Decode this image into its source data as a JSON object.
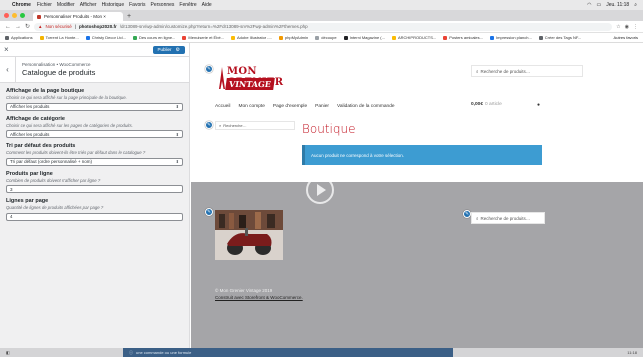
{
  "menubar": {
    "app": "Chrome",
    "items": [
      "Fichier",
      "Modifier",
      "Afficher",
      "Historique",
      "Favoris",
      "Personnes",
      "Fenêtre",
      "Aide"
    ],
    "clock": "Jeu. 11:18"
  },
  "tab": {
    "title": "Personnaliser Produits - Mon ×"
  },
  "address": {
    "warning": "Non sécurisé",
    "host": "photoshop2020.fr",
    "path": "/dr13089-srv/wp-admin/customize.php?return=%2Fdr13089-srv%2Fwp-admin%2Fthemes.php"
  },
  "bookmarks": [
    {
      "label": "Applications",
      "color": "#5f6368"
    },
    {
      "label": "Torrent La Honte...",
      "color": "#f4b400"
    },
    {
      "label": "Christy Decor Ltd...",
      "color": "#1a73e8"
    },
    {
      "label": "Des cours en ligne...",
      "color": "#34a853"
    },
    {
      "label": "Menuiserie et Ébé...",
      "color": "#ea4335"
    },
    {
      "label": "Adobe Illustrator -...",
      "color": "#fbbc05"
    },
    {
      "label": "phpMyAdmin",
      "color": "#f29900"
    },
    {
      "label": "découpe",
      "color": "#9aa0a6"
    },
    {
      "label": "Interni Magazine (...",
      "color": "#202124"
    },
    {
      "label": "ARCHIPRODUCTS...",
      "color": "#fbbc05"
    },
    {
      "label": "Posters amicales...",
      "color": "#ea4335"
    },
    {
      "label": "Impression planch...",
      "color": "#1a73e8"
    },
    {
      "label": "Créer des Tags NF...",
      "color": "#5f6368"
    }
  ],
  "bookmarks_other": "Autres favoris",
  "sidebar": {
    "publish_label": "Publier",
    "crumb": "Personnalisation • WooCommerce",
    "title": "Catalogue de produits",
    "controls": [
      {
        "label": "Affichage de la page boutique",
        "desc": "Choisir ce qui sera affiché sur la page principale de la boutique.",
        "value": "Afficher les produits"
      },
      {
        "label": "Affichage de catégorie",
        "desc": "Choisir ce qui sera affiché sur les pages de catégories de produits.",
        "value": "Afficher les produits"
      },
      {
        "label": "Tri par défaut des produits",
        "desc": "Comment les produits doivent-ils être triés par défaut dans le catalogue ?",
        "value": "Tri par défaut (ordre personnalisé + nom)"
      },
      {
        "label": "Produits par ligne",
        "desc": "Combien de produits doivent s'afficher par ligne ?",
        "value": "3"
      },
      {
        "label": "Lignes par page",
        "desc": "Quantité de lignes de produits affichées par page ?",
        "value": "4"
      }
    ]
  },
  "preview": {
    "logo_line1": "MON GRENIER",
    "logo_line2": "VINTAGE",
    "search_placeholder": "Recherche de produits…",
    "nav": [
      "Accueil",
      "Mon compte",
      "Page d'exemple",
      "Panier",
      "Validation de la commande"
    ],
    "cart_amount": "0,00€",
    "cart_items": "0 article",
    "side_search": "Recherche…",
    "page_title": "Boutique",
    "notice": "Aucun produit ne correspond à votre sélection.",
    "footer_search": "Recherche de produits…",
    "copyright": "© Mon Grenier Vintage 2019",
    "built_with": "Construit avec Storefront & WooCommerce."
  },
  "bottombar": {
    "notice": "une commande ou une formule",
    "clock": "11:18"
  },
  "colors": {
    "accent": "#2271b1",
    "brand_red": "#b5101f",
    "notice_blue": "#3d9cd2"
  }
}
